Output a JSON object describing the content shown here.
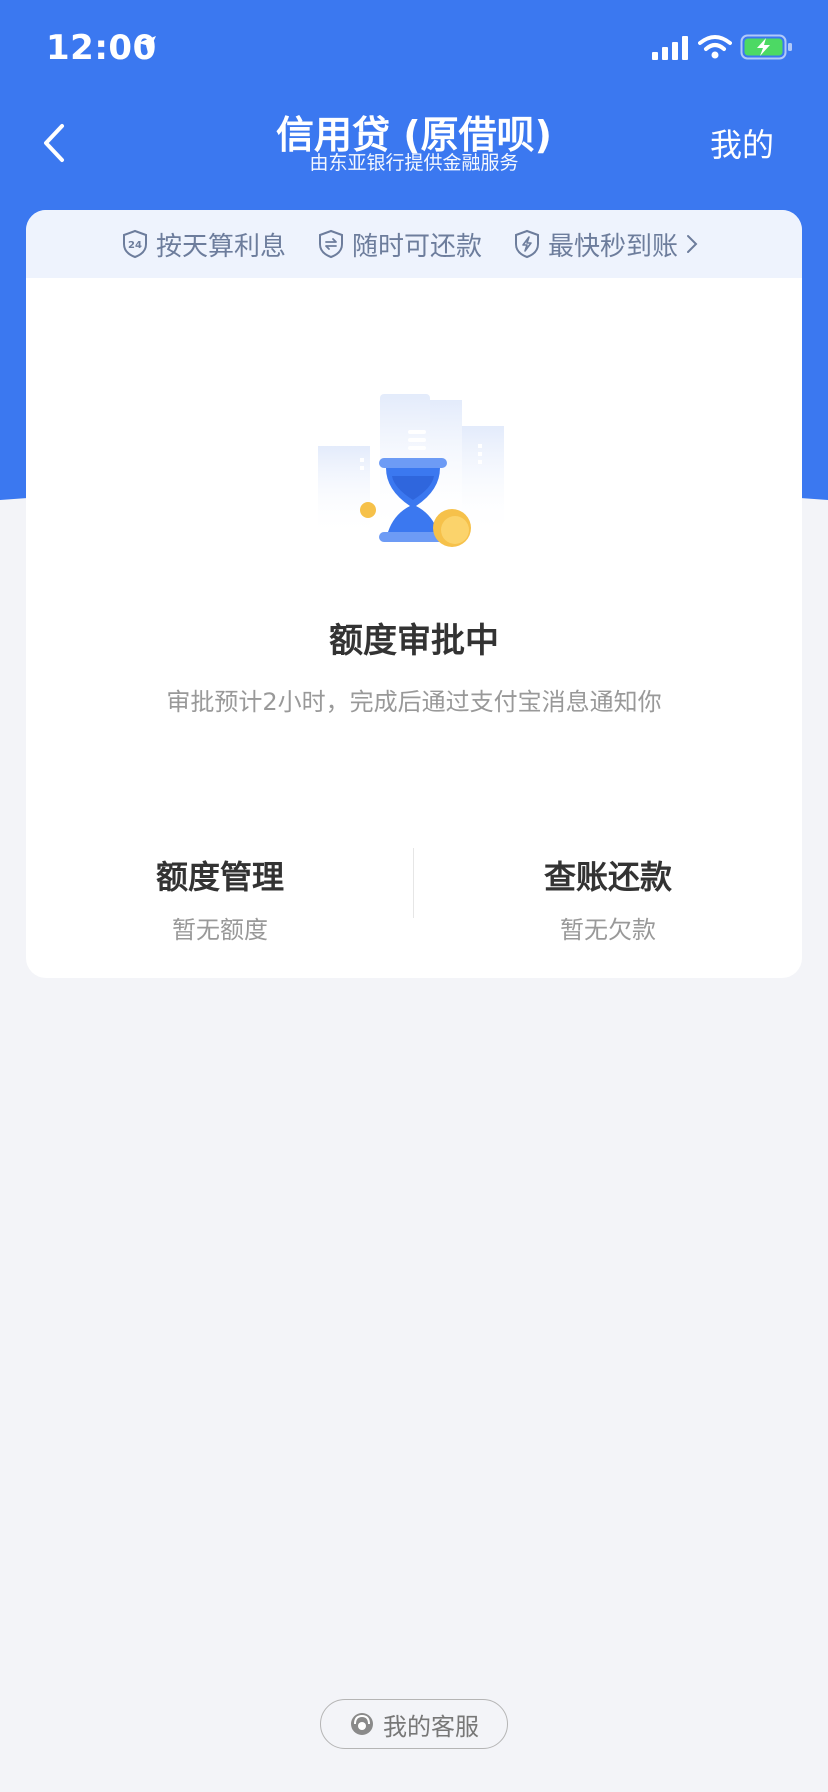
{
  "status_bar": {
    "time": "12:00"
  },
  "nav": {
    "title": "信用贷 (原借呗)",
    "subtitle": "由东亚银行提供金融服务",
    "right_link": "我的"
  },
  "features": {
    "items": [
      {
        "label": "按天算利息",
        "icon": "24h-shield-icon"
      },
      {
        "label": "随时可还款",
        "icon": "exchange-shield-icon"
      },
      {
        "label": "最快秒到账",
        "icon": "lightning-shield-icon"
      }
    ]
  },
  "status": {
    "title": "额度审批中",
    "description": "审批预计2小时，完成后通过支付宝消息通知你"
  },
  "tiles": {
    "left": {
      "title": "额度管理",
      "subtitle": "暂无额度"
    },
    "right": {
      "title": "查账还款",
      "subtitle": "暂无欠款"
    }
  },
  "footer": {
    "service_label": "我的客服"
  },
  "colors": {
    "primary": "#3b78f0",
    "background": "#f3f4f8",
    "coin": "#f6c14a"
  }
}
